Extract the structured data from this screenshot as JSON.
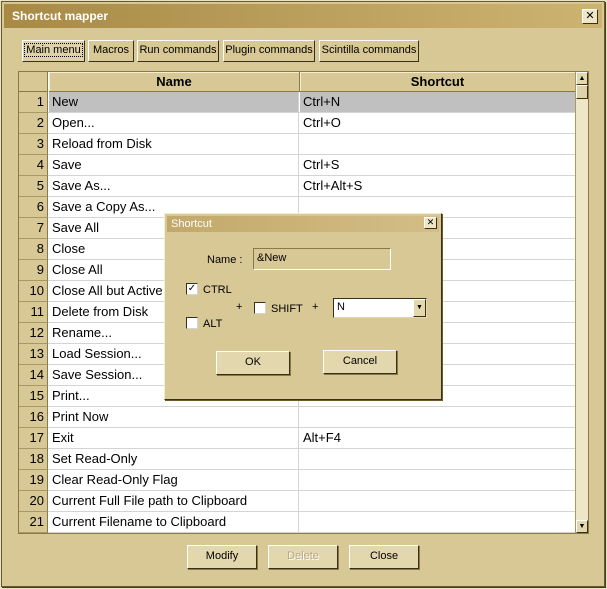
{
  "window": {
    "title": "Shortcut mapper",
    "close_glyph": "✕"
  },
  "tabs": [
    {
      "label": "Main menu",
      "active": true
    },
    {
      "label": "Macros",
      "active": false
    },
    {
      "label": "Run commands",
      "active": false
    },
    {
      "label": "Plugin commands",
      "active": false
    },
    {
      "label": "Scintilla commands",
      "active": false
    }
  ],
  "table": {
    "columns": [
      "Name",
      "Shortcut"
    ],
    "rows": [
      {
        "num": "1",
        "name": "New",
        "shortcut": "Ctrl+N",
        "selected": true
      },
      {
        "num": "2",
        "name": "Open...",
        "shortcut": "Ctrl+O"
      },
      {
        "num": "3",
        "name": "Reload from Disk",
        "shortcut": ""
      },
      {
        "num": "4",
        "name": "Save",
        "shortcut": "Ctrl+S"
      },
      {
        "num": "5",
        "name": "Save As...",
        "shortcut": "Ctrl+Alt+S"
      },
      {
        "num": "6",
        "name": "Save a Copy As...",
        "shortcut": ""
      },
      {
        "num": "7",
        "name": "Save All",
        "shortcut": ""
      },
      {
        "num": "8",
        "name": "Close",
        "shortcut": ""
      },
      {
        "num": "9",
        "name": "Close All",
        "shortcut": ""
      },
      {
        "num": "10",
        "name": "Close All but Active",
        "shortcut": ""
      },
      {
        "num": "11",
        "name": "Delete from Disk",
        "shortcut": ""
      },
      {
        "num": "12",
        "name": "Rename...",
        "shortcut": ""
      },
      {
        "num": "13",
        "name": "Load Session...",
        "shortcut": ""
      },
      {
        "num": "14",
        "name": "Save Session...",
        "shortcut": ""
      },
      {
        "num": "15",
        "name": "Print...",
        "shortcut": ""
      },
      {
        "num": "16",
        "name": "Print Now",
        "shortcut": ""
      },
      {
        "num": "17",
        "name": "Exit",
        "shortcut": "Alt+F4"
      },
      {
        "num": "18",
        "name": "Set Read-Only",
        "shortcut": ""
      },
      {
        "num": "19",
        "name": "Clear Read-Only Flag",
        "shortcut": ""
      },
      {
        "num": "20",
        "name": "Current Full File path to Clipboard",
        "shortcut": ""
      },
      {
        "num": "21",
        "name": "Current Filename to Clipboard",
        "shortcut": ""
      }
    ]
  },
  "scrollbar": {
    "up_glyph": "▲",
    "down_glyph": "▼"
  },
  "buttons": {
    "modify": "Modify",
    "delete": "Delete",
    "close": "Close"
  },
  "dialog": {
    "title": "Shortcut",
    "close_glyph": "✕",
    "name_label": "Name :",
    "name_value": "&New",
    "ctrl_label": "CTRL",
    "ctrl_checked": true,
    "alt_label": "ALT",
    "alt_checked": false,
    "shift_label": "SHIFT",
    "shift_checked": false,
    "plus1": "+",
    "plus2": "+",
    "key_value": "N",
    "combo_arrow": "▼",
    "check_glyph": "✓",
    "ok_label": "OK",
    "cancel_label": "Cancel"
  }
}
